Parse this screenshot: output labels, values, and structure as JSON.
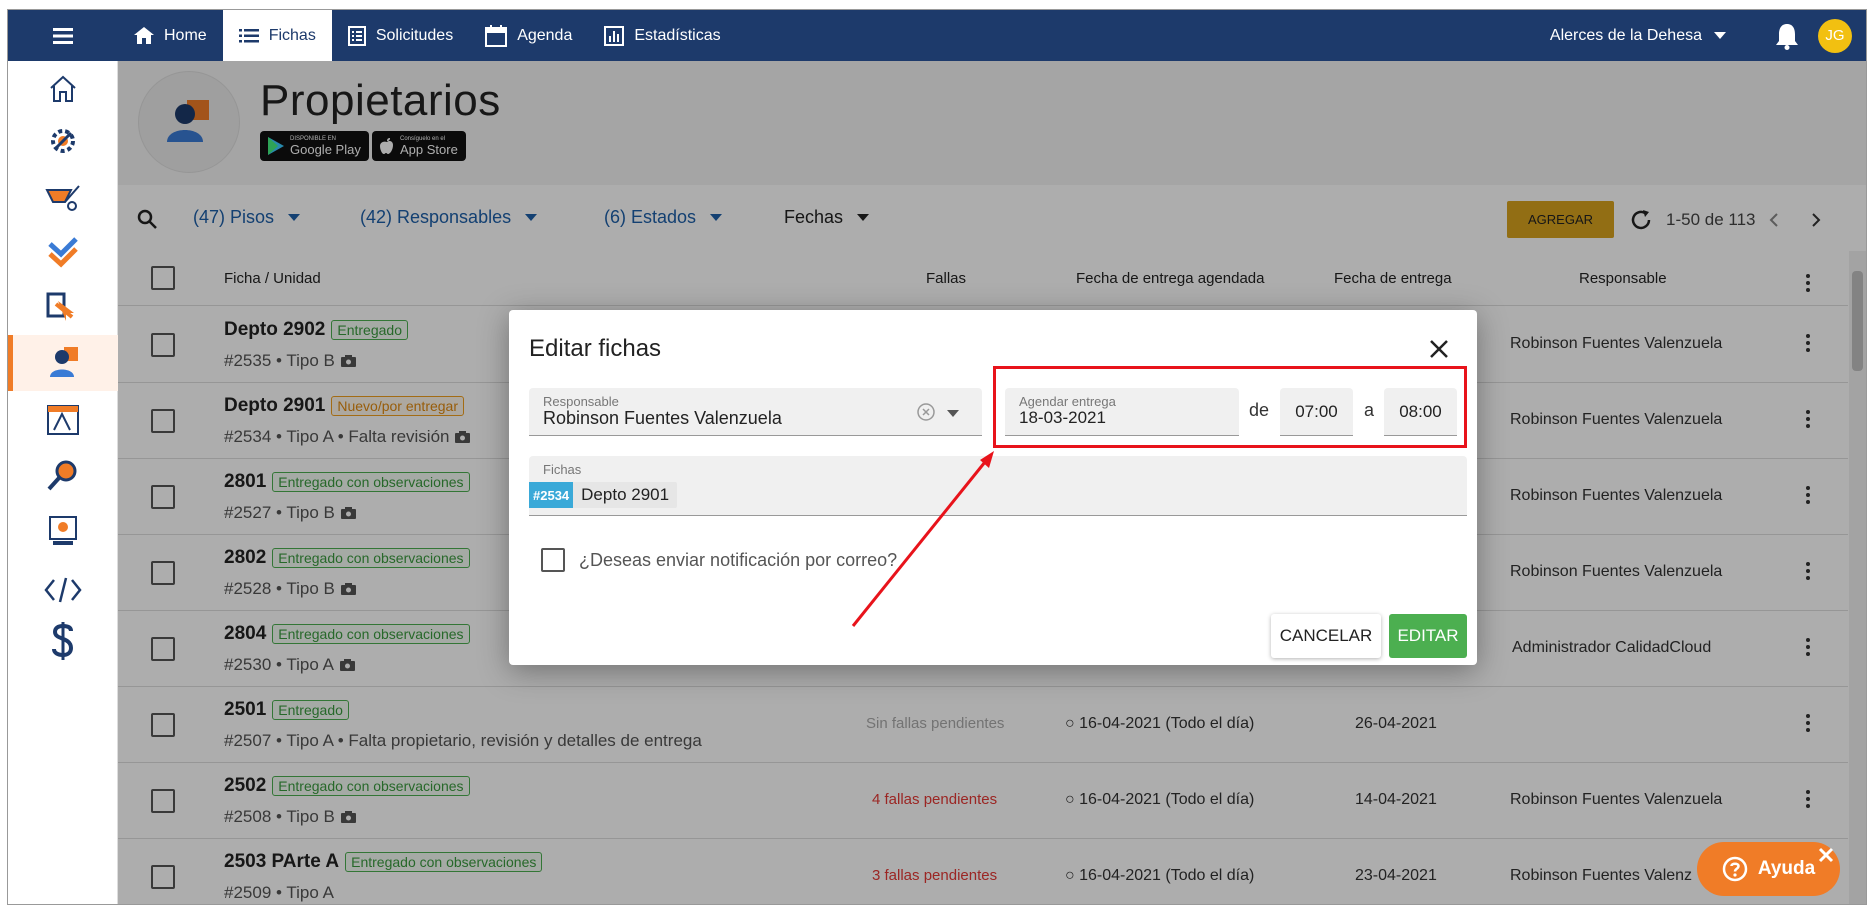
{
  "nav": {
    "home": "Home",
    "fichas": "Fichas",
    "solicitudes": "Solicitudes",
    "agenda": "Agenda",
    "estadisticas": "Estadísticas",
    "project": "Alerces de la Dehesa",
    "user_initials": "JG"
  },
  "page": {
    "title": "Propietarios",
    "google_play_small": "DISPONIBLE EN",
    "google_play_big": "Google Play",
    "app_store_small": "Consíguelo en el",
    "app_store_big": "App Store"
  },
  "filters": {
    "pisos": "(47) Pisos",
    "responsables": "(42) Responsables",
    "estados": "(6) Estados",
    "fechas": "Fechas",
    "add": "AGREGAR",
    "pagination": "1-50 de 113"
  },
  "table": {
    "headers": {
      "unit": "Ficha / Unidad",
      "fallas": "Fallas",
      "scheduled": "Fecha de entrega agendada",
      "delivery": "Fecha de entrega",
      "responsible": "Responsable"
    },
    "rows": [
      {
        "name": "Depto 2902",
        "status": "Entregado",
        "sub": "#2535 • Tipo B",
        "fallas": "",
        "scheduled": "",
        "delivery": "",
        "responsible": "Robinson Fuentes Valenzuela"
      },
      {
        "name": "Depto 2901",
        "status": "Nuevo/por entregar",
        "sub": "#2534 • Tipo A • Falta revisión",
        "fallas": "",
        "scheduled": "",
        "delivery": "",
        "responsible": "Robinson Fuentes Valenzuela"
      },
      {
        "name": "2801",
        "status": "Entregado con observaciones",
        "sub": "#2527 • Tipo B",
        "fallas": "",
        "scheduled": "",
        "delivery": "",
        "responsible": "Robinson Fuentes Valenzuela"
      },
      {
        "name": "2802",
        "status": "Entregado con observaciones",
        "sub": "#2528 • Tipo B",
        "fallas": "",
        "scheduled": "",
        "delivery": "",
        "responsible": "Robinson Fuentes Valenzuela"
      },
      {
        "name": "2804",
        "status": "Entregado con observaciones",
        "sub": "#2530 • Tipo A",
        "fallas": "",
        "scheduled": "",
        "delivery": "",
        "responsible": "Administrador CalidadCloud"
      },
      {
        "name": "2501",
        "status": "Entregado",
        "sub": "#2507 • Tipo A • Falta propietario, revisión y detalles de entrega",
        "fallas": "Sin fallas pendientes",
        "scheduled": "○ 16-04-2021 (Todo el día)",
        "delivery": "26-04-2021",
        "responsible": ""
      },
      {
        "name": "2502",
        "status": "Entregado con observaciones",
        "sub": "#2508 • Tipo B",
        "fallas": "4 fallas pendientes",
        "scheduled": "○ 16-04-2021 (Todo el día)",
        "delivery": "14-04-2021",
        "responsible": "Robinson Fuentes Valenzuela"
      },
      {
        "name": "2503 PArte A",
        "status": "Entregado con observaciones",
        "sub": "#2509 • Tipo A",
        "fallas": "3 fallas pendientes",
        "scheduled": "○ 16-04-2021 (Todo el día)",
        "delivery": "23-04-2021",
        "responsible": "Robinson Fuentes Valenz"
      }
    ]
  },
  "modal": {
    "title": "Editar fichas",
    "responsable_label": "Responsable",
    "responsable_value": "Robinson Fuentes Valenzuela",
    "agendar_label": "Agendar entrega",
    "agendar_value": "18-03-2021",
    "de": "de",
    "from_time": "07:00",
    "a": "a",
    "to_time": "08:00",
    "fichas_label": "Fichas",
    "chip_id": "#2534",
    "chip_name": "Depto 2901",
    "notify": "¿Deseas enviar notificación por correo?",
    "cancel": "CANCELAR",
    "edit": "EDITAR"
  },
  "help": {
    "label": "Ayuda"
  },
  "colors": {
    "nav": "#1d3a6b",
    "accent": "#f07c27",
    "success": "#4caf50",
    "highlight": "#e8131b"
  }
}
